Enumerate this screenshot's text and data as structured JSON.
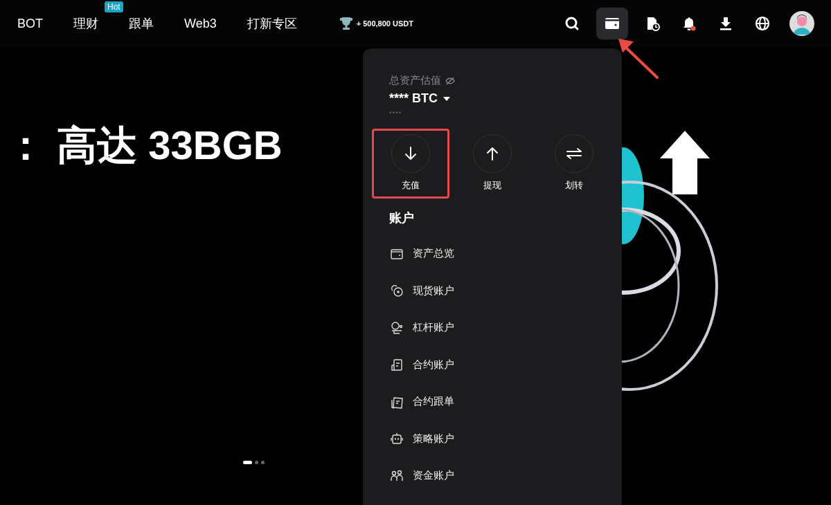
{
  "nav": {
    "items": [
      {
        "label": "BOT"
      },
      {
        "label": "理财",
        "badge": "Hot"
      },
      {
        "label": "跟单"
      },
      {
        "label": "Web3"
      },
      {
        "label": "打新专区"
      }
    ],
    "reward": "+ 500,800 USDT",
    "icons": [
      {
        "selected": false,
        "alert": false
      },
      {
        "selected": true,
        "alert": false
      },
      {
        "selected": false,
        "alert": false
      },
      {
        "selected": false,
        "alert": true
      },
      {
        "selected": false,
        "alert": false
      },
      {
        "selected": false,
        "alert": false
      }
    ]
  },
  "hero": {
    "title": "： 高达 33BGB",
    "dots": [
      {
        "selected": true
      },
      {
        "selected": false
      },
      {
        "selected": false
      }
    ]
  },
  "wallet_menu": {
    "label": "总资产估值",
    "balance": "**** BTC",
    "sub_balance": "****",
    "actions": [
      {
        "label": "充值",
        "highlighted": true
      },
      {
        "label": "提现",
        "highlighted": false
      },
      {
        "label": "划转",
        "highlighted": false
      }
    ],
    "section_title": "账户",
    "items": [
      {
        "label": "资产总览"
      },
      {
        "label": "现货账户"
      },
      {
        "label": "杠杆账户"
      },
      {
        "label": "合约账户"
      },
      {
        "label": "合约跟单"
      },
      {
        "label": "策略账户"
      },
      {
        "label": "资金账户"
      }
    ]
  }
}
